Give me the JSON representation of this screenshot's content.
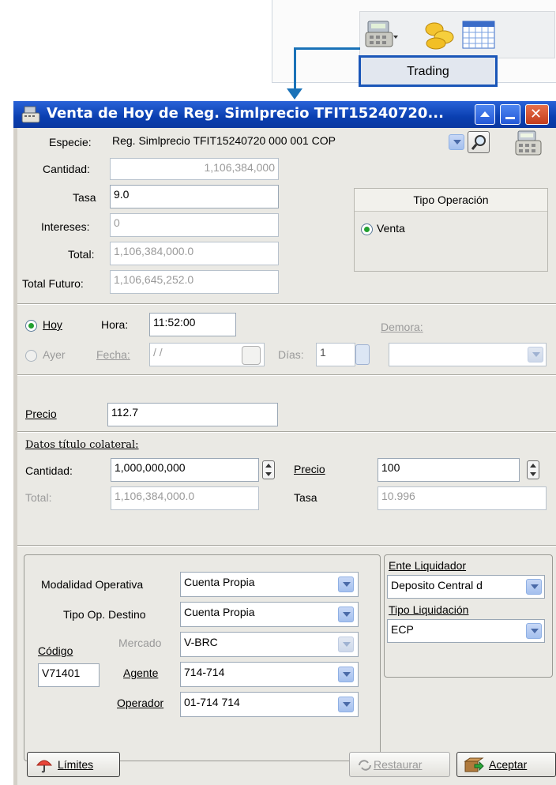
{
  "toolbar": {
    "trading_label": "Trading",
    "icons": [
      "cash-register-icon",
      "coins-icon",
      "calendar-grid-icon"
    ]
  },
  "window": {
    "title": "Venta de Hoy de Reg. Simlprecio TFIT15240720...",
    "icon": "cash-register-icon"
  },
  "form": {
    "especie_label": "Especie:",
    "especie_value": "Reg. Simlprecio TFIT15240720 000 001 COP",
    "cantidad_label": "Cantidad:",
    "cantidad_value": "1,106,384,000",
    "tasa_label": "Tasa",
    "tasa_value": "9.0",
    "intereses_label": "Intereses:",
    "intereses_value": "0",
    "total_label": "Total:",
    "total_value": "1,106,384,000.0",
    "total_futuro_label": "Total Futuro:",
    "total_futuro_value": "1,106,645,252.0",
    "tipo_operacion_title": "Tipo Operación",
    "tipo_operacion_option": "Venta"
  },
  "timing": {
    "hoy_label": "Hoy",
    "ayer_label": "Ayer",
    "hora_label": "Hora:",
    "hora_value": "11:52:00",
    "fecha_label": "Fecha:",
    "fecha_value": " /  /",
    "dias_label": "Días:",
    "dias_value": "1",
    "demora_label": "Demora:"
  },
  "precio": {
    "label": "Precio",
    "value": "112.7"
  },
  "colateral": {
    "title": "Datos título colateral:",
    "cantidad_label": "Cantidad:",
    "cantidad_value": "1,000,000,000",
    "precio_label": "Precio",
    "precio_value": "100",
    "total_label": "Total:",
    "total_value": "1,106,384,000.0",
    "tasa_label": "Tasa",
    "tasa_value": "10.996"
  },
  "operacion": {
    "modalidad_label": "Modalidad Operativa",
    "modalidad_value": "Cuenta Propia",
    "tipo_destino_label": "Tipo Op. Destino",
    "tipo_destino_value": "Cuenta Propia",
    "mercado_label": "Mercado",
    "mercado_value": "V-BRC",
    "codigo_label": "Código",
    "codigo_value": "V71401",
    "agente_label": "Agente",
    "agente_value": "714-714",
    "operador_label": "Operador",
    "operador_value": "01-714 714"
  },
  "liquidacion": {
    "ente_label": "Ente Liquidador",
    "ente_value": "Deposito Central d",
    "tipo_label": "Tipo Liquidación",
    "tipo_value": "ECP"
  },
  "buttons": {
    "limites": "Límites",
    "restaurar": "Restaurar",
    "aceptar": "Aceptar"
  }
}
